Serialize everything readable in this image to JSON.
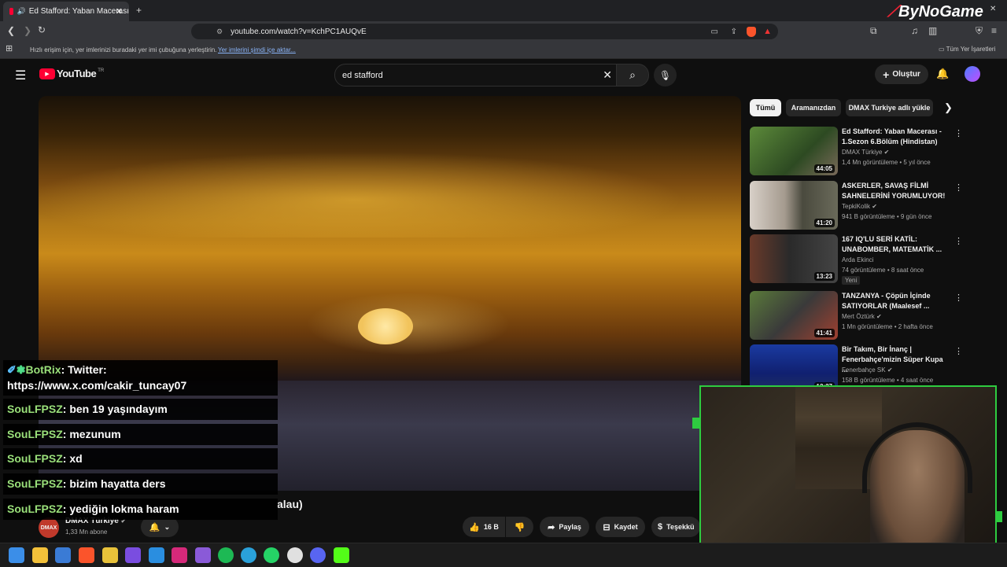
{
  "browser": {
    "tab_title": "Ed Stafford: Yaban Macerası",
    "url": "youtube.com/watch?v=KchPC1AUQvE",
    "bookmarks_hint": "Hızlı erişim için, yer imlerinizi buradaki yer imi çubuğuna yerleştirin.",
    "bookmarks_import_link": "Yer imlerini şimdi içe aktar...",
    "all_bookmarks": "Tüm Yer İşaretleri",
    "watermark": "ByNoGame"
  },
  "youtube": {
    "logo_text": "YouTube",
    "logo_region": "TR",
    "search_value": "ed stafford",
    "create_label": "Oluştur"
  },
  "chips": [
    "Tümü",
    "Aramanızdan",
    "DMAX Turkiye adlı yükle"
  ],
  "recommendations": [
    {
      "title": "Ed Stafford: Yaban Macerası - 1.Sezon 6.Bölüm (Hindistan)",
      "channel": "DMAX Türkiye",
      "meta": "1,4 Mn görüntüleme • 5 yıl önce",
      "duration": "44:05",
      "badge": ""
    },
    {
      "title": "ASKERLER, SAVAŞ FİLMİ SAHNELERİNİ YORUMLUYOR!",
      "channel": "TepkiKolik",
      "meta": "941 B görüntüleme • 9 gün önce",
      "duration": "41:20",
      "badge": ""
    },
    {
      "title": "167 IQ'LU SERİ KATİL: UNABOMBER, MATEMATİK ...",
      "channel": "Arda Ekinci",
      "meta": "74 görüntüleme • 8 saat önce",
      "duration": "13:23",
      "badge": "Yeni"
    },
    {
      "title": "TANZANYA - Çöpün İçinde SATIYORLAR (Maalesef ...",
      "channel": "Mert Öztürk",
      "meta": "1 Mn görüntüleme • 2 hafta önce",
      "duration": "41:41",
      "badge": ""
    },
    {
      "title": "Bir Takım, Bir İnanç | Fenerbahçe'mizin Süper Kupa ...",
      "channel": "Fenerbahçe SK",
      "meta": "158 B görüntüleme • 4 saat önce",
      "duration": "12:27",
      "badge": ""
    }
  ],
  "chat": [
    {
      "user": "BotRix",
      "message": "Twitter:",
      "line2": "https://www.x.com/cakir_tuncay07"
    },
    {
      "user": "SouLFPSZ",
      "message": "ben 19 yaşındayım"
    },
    {
      "user": "SouLFPSZ",
      "message": "mezunum"
    },
    {
      "user": "SouLFPSZ",
      "message": "xd"
    },
    {
      "user": "SouLFPSZ",
      "message": "bizim hayatta ders"
    },
    {
      "user": "SouLFPSZ",
      "message": "yediğin lokma haram"
    }
  ],
  "video_below": {
    "title_fragment": "alau)",
    "channel": "DMAX Türkiye",
    "channel_avatar_text": "DMAX",
    "subscribers": "1,33 Mn abone",
    "likes": "16 B",
    "share": "Paylaş",
    "save": "Kaydet",
    "thanks": "Teşekkü"
  },
  "colors": {
    "accent_red": "#ff0033",
    "chat_user": "#9ae07a",
    "cam_border": "#2ecc40"
  }
}
